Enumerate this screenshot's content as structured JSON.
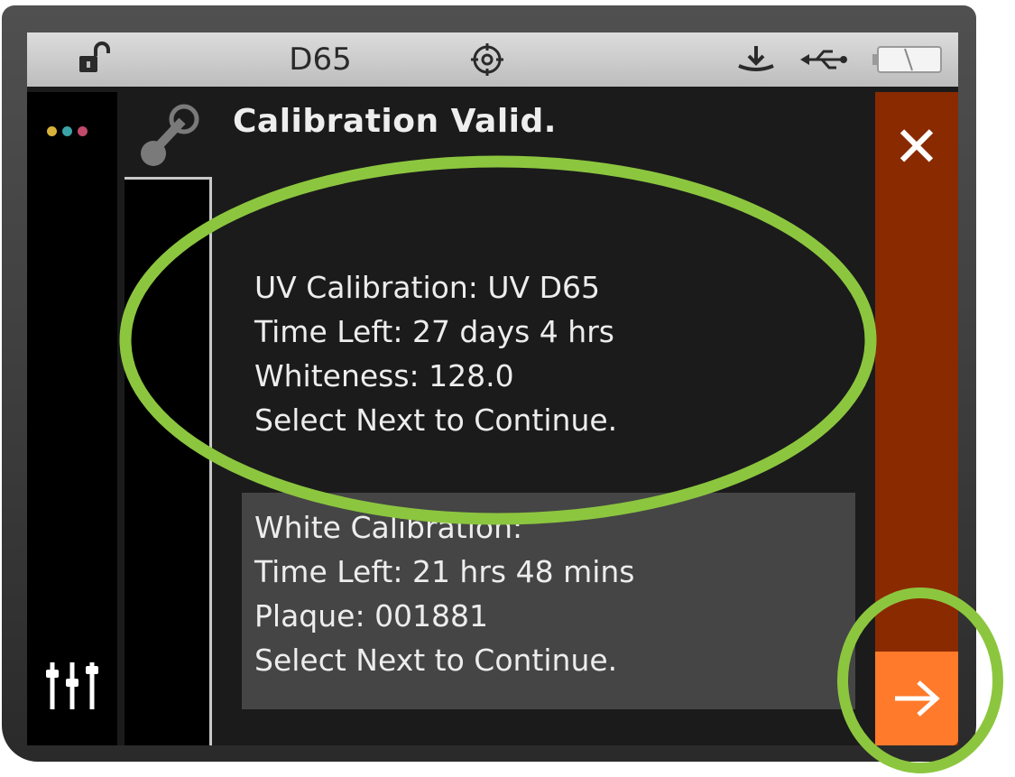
{
  "status_bar": {
    "lock_icon": "unlocked-padlock-icon",
    "illuminant": "D65",
    "target_icon": "crosshair-icon",
    "dock_icon": "dock-icon",
    "usb_icon": "usb-icon",
    "battery_icon": "battery-icon"
  },
  "sidebar": {
    "dots_colors": [
      "#d9b23a",
      "#3aa3a8",
      "#c24a6a"
    ],
    "settings_icon": "sliders-icon"
  },
  "dialog": {
    "title": "Calibration Valid.",
    "uv_lines": [
      "UV Calibration: UV D65",
      "Time Left: 27 days 4 hrs",
      "Whiteness: 128.0",
      "Select Next to Continue."
    ],
    "white_lines": [
      "White Calibration:",
      "Time Left: 21 hrs 48 mins",
      "Plaque: 001881",
      "Select Next to Continue."
    ]
  },
  "actions": {
    "close_label": "✕",
    "next_icon": "arrow-right-icon",
    "column_color": "#8a2a00",
    "next_color": "#ff7a2a"
  },
  "annotations": {
    "highlight_color": "#8cc63f"
  }
}
